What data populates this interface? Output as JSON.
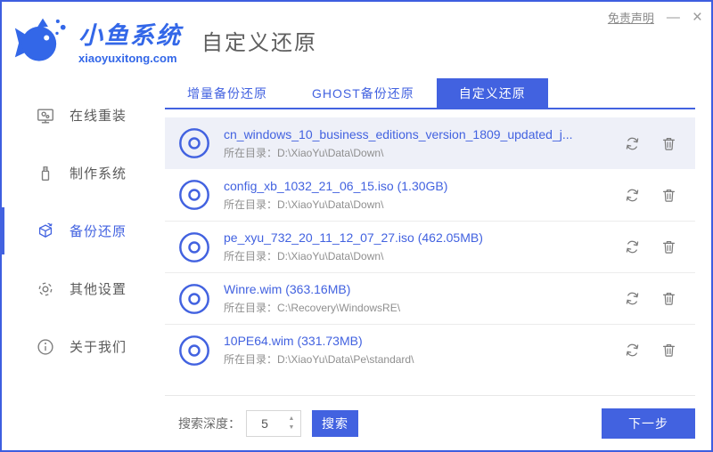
{
  "window": {
    "disclaimer": "免责声明",
    "minimize": "—",
    "close": "×"
  },
  "brand": {
    "name": "小鱼系统",
    "domain": "xiaoyuxitong.com"
  },
  "page": {
    "title": "自定义还原"
  },
  "sidebar": {
    "items": [
      {
        "label": "在线重装",
        "icon": "monitor-icon",
        "key": "online-reinstall",
        "active": false
      },
      {
        "label": "制作系统",
        "icon": "usb-icon",
        "key": "make-system",
        "active": false
      },
      {
        "label": "备份还原",
        "icon": "backup-icon",
        "key": "backup-restore",
        "active": true
      },
      {
        "label": "其他设置",
        "icon": "gear-icon",
        "key": "other-settings",
        "active": false
      },
      {
        "label": "关于我们",
        "icon": "info-icon",
        "key": "about-us",
        "active": false
      }
    ]
  },
  "tabs": [
    {
      "label": "增量备份还原",
      "active": false
    },
    {
      "label": "GHOST备份还原",
      "active": false
    },
    {
      "label": "自定义还原",
      "active": true
    }
  ],
  "list": {
    "path_label": "所在目录：",
    "items": [
      {
        "name": "cn_windows_10_business_editions_version_1809_updated_j...",
        "path": "D:\\XiaoYu\\Data\\Down\\",
        "selected": true
      },
      {
        "name": "config_xb_1032_21_06_15.iso (1.30GB)",
        "path": "D:\\XiaoYu\\Data\\Down\\",
        "selected": false
      },
      {
        "name": "pe_xyu_732_20_11_12_07_27.iso (462.05MB)",
        "path": "D:\\XiaoYu\\Data\\Down\\",
        "selected": false
      },
      {
        "name": "Winre.wim (363.16MB)",
        "path": "C:\\Recovery\\WindowsRE\\",
        "selected": false
      },
      {
        "name": "10PE64.wim (331.73MB)",
        "path": "D:\\XiaoYu\\Data\\Pe\\standard\\",
        "selected": false
      }
    ]
  },
  "footer": {
    "depth_label": "搜索深度：",
    "depth_value": "5",
    "search_label": "搜索",
    "next_label": "下一步"
  },
  "icons": {
    "spinner_up": "▲",
    "spinner_down": "▼"
  },
  "colors": {
    "accent": "#4262e0",
    "logo_blue": "#3367e8",
    "selected_row_bg": "#eef0f8",
    "window_border": "#3d5ee0",
    "path_text": "#8f8f8f"
  }
}
